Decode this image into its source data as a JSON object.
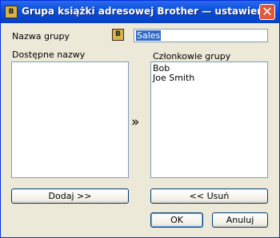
{
  "window": {
    "title": "Grupa książki adresowej Brother — ustawienia",
    "app_icon_glyph": "B",
    "close_glyph": "✕"
  },
  "group_name": {
    "label": "Nazwa grupy",
    "icon_glyph": "B",
    "value": "Sales"
  },
  "available": {
    "label": "Dostępne nazwy",
    "items": []
  },
  "members": {
    "label": "Członkowie grupy",
    "items": [
      "Bob",
      "Joe Smith"
    ]
  },
  "transfer_arrow": "»",
  "buttons": {
    "add": "Dodaj >>",
    "remove": "<< Usuń",
    "ok": "OK",
    "cancel": "Anuluj"
  }
}
